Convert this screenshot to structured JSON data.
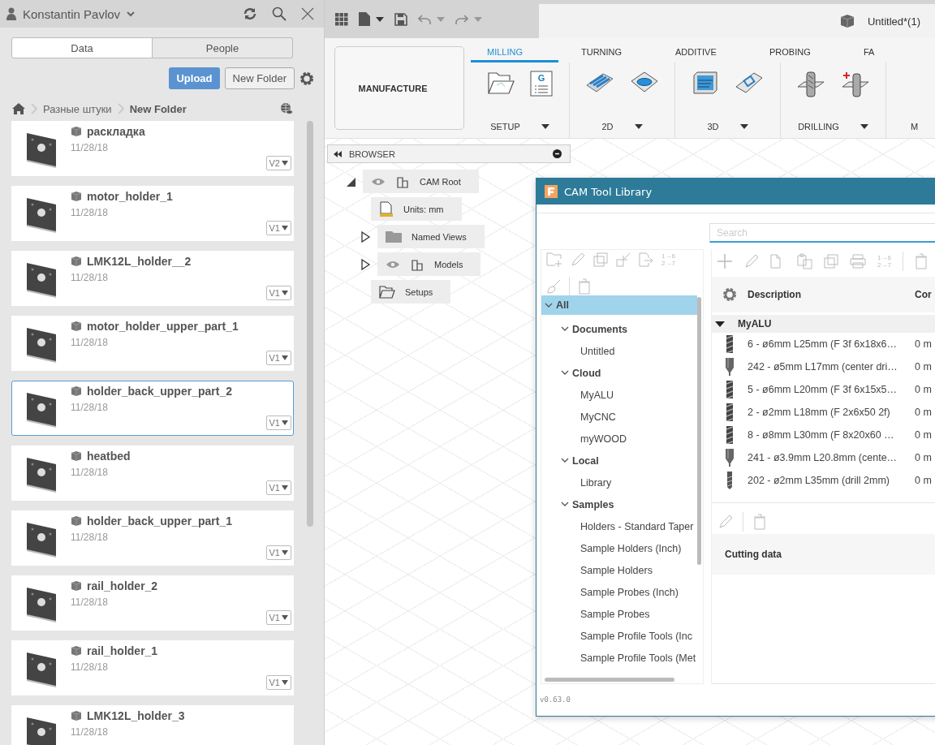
{
  "user_panel": {
    "user_name": "Konstantin Pavlov",
    "tabs": [
      {
        "label": "Data",
        "selected": true
      },
      {
        "label": "People",
        "selected": false
      }
    ],
    "buttons": [
      {
        "label": "Upload",
        "kind": "primary"
      },
      {
        "label": "New Folder",
        "kind": "secondary"
      }
    ],
    "breadcrumb": [
      {
        "label": "Разные штуки",
        "current": false
      },
      {
        "label": "New Folder",
        "current": true
      }
    ],
    "files": [
      {
        "name": "раскладка",
        "date": "11/28/18",
        "version": "V2",
        "selected": false
      },
      {
        "name": "motor_holder_1",
        "date": "11/28/18",
        "version": "V1",
        "selected": false
      },
      {
        "name": "LMK12L_holder__2",
        "date": "11/28/18",
        "version": "V1",
        "selected": false
      },
      {
        "name": "motor_holder_upper_part_1",
        "date": "11/28/18",
        "version": "V1",
        "selected": false
      },
      {
        "name": "holder_back_upper_part_2",
        "date": "11/28/18",
        "version": "V1",
        "selected": true
      },
      {
        "name": "heatbed",
        "date": "11/28/18",
        "version": "V1",
        "selected": false
      },
      {
        "name": "holder_back_upper_part_1",
        "date": "11/28/18",
        "version": "V1",
        "selected": false
      },
      {
        "name": "rail_holder_2",
        "date": "11/28/18",
        "version": "V1",
        "selected": false
      },
      {
        "name": "rail_holder_1",
        "date": "11/28/18",
        "version": "V1",
        "selected": false
      },
      {
        "name": "LMK12L_holder_3",
        "date": "11/28/18",
        "selected": false
      }
    ]
  },
  "document_tab": {
    "title": "Untitled*(1)"
  },
  "ribbon": {
    "workspace": "MANUFACTURE",
    "program_icon_text": "G",
    "tabs": [
      {
        "label": "MILLING",
        "selected": true
      },
      {
        "label": "TURNING",
        "selected": false
      },
      {
        "label": "ADDITIVE",
        "selected": false
      },
      {
        "label": "PROBING",
        "selected": false
      },
      {
        "label": "FA",
        "selected": false
      }
    ],
    "groups": [
      {
        "kind": "setup",
        "label": "SETUP"
      },
      {
        "kind": "planar",
        "label": "2D"
      },
      {
        "kind": "surface",
        "label": "3D"
      },
      {
        "kind": "drilling",
        "label": "DRILLING"
      },
      {
        "kind": "cut",
        "label": "M"
      }
    ]
  },
  "browser": {
    "title": "BROWSER",
    "tree": [
      {
        "kind": "root",
        "label": "CAM Root",
        "expanded": true,
        "children": [
          {
            "kind": "units",
            "label": "Units: mm"
          },
          {
            "kind": "views",
            "label": "Named Views",
            "expanded": false
          },
          {
            "kind": "models",
            "label": "Models",
            "expanded": false
          },
          {
            "kind": "setups",
            "label": "Setups"
          }
        ]
      }
    ]
  },
  "tool_library": {
    "title": "CAM Tool Library",
    "search": {
      "placeholder": "Search"
    },
    "tree_toolbar_renumber": [
      "1→6",
      "2→7"
    ],
    "list_toolbar_renumber": [
      "1→6",
      "2→7"
    ],
    "tree": [
      {
        "label": "All",
        "selected": true,
        "expanded": true,
        "children": [
          {
            "label": "Documents",
            "selected": false,
            "expanded": true,
            "children": [
              {
                "label": "Untitled",
                "selected": false
              }
            ]
          },
          {
            "label": "Cloud",
            "selected": false,
            "expanded": true,
            "children": [
              {
                "label": "MyALU",
                "selected": false
              },
              {
                "label": "MyCNC",
                "selected": false
              },
              {
                "label": "myWOOD",
                "selected": false
              }
            ]
          },
          {
            "label": "Local",
            "selected": false,
            "expanded": true,
            "children": [
              {
                "label": "Library",
                "selected": false
              }
            ]
          },
          {
            "label": "Samples",
            "selected": false,
            "expanded": true,
            "children": [
              {
                "label": "Holders - Standard Taper",
                "selected": false
              },
              {
                "label": "Sample Holders (Inch)",
                "selected": false
              },
              {
                "label": "Sample Holders",
                "selected": false
              },
              {
                "label": "Sample Probes (Inch)",
                "selected": false
              },
              {
                "label": "Sample Probes",
                "selected": false
              },
              {
                "label": "Sample Profile Tools (Inc",
                "selected": false
              },
              {
                "label": "Sample Profile Tools (Met",
                "selected": false
              }
            ]
          }
        ]
      }
    ],
    "columns": [
      "Description",
      "Cor"
    ],
    "group": {
      "label": "MyALU",
      "expanded": true
    },
    "tools": [
      {
        "kind": "endmill",
        "description": "6 - ø6mm L25mm (F 3f 6x18x6…",
        "column_2": "0 m"
      },
      {
        "kind": "center-drill",
        "description": "242 - ø5mm L17mm (center dri…",
        "column_2": "0 m"
      },
      {
        "kind": "endmill",
        "description": "5 - ø6mm L20mm (F 3f 6x15x5…",
        "column_2": "0 m"
      },
      {
        "kind": "endmill",
        "description": "2 - ø2mm L18mm (F 2x6x50 2f)",
        "column_2": "0 m"
      },
      {
        "kind": "endmill",
        "description": "8 - ø8mm L30mm (F 8x20x60 …",
        "column_2": "0 m"
      },
      {
        "kind": "center-drill",
        "description": "241 - ø3.9mm L20.8mm (cente…",
        "column_2": "0 m"
      },
      {
        "kind": "drill",
        "description": "202 - ø2mm L35mm (drill 2mm)",
        "column_2": "0 m"
      }
    ],
    "detail_title": "Cutting data",
    "version": "v0.63.0"
  }
}
